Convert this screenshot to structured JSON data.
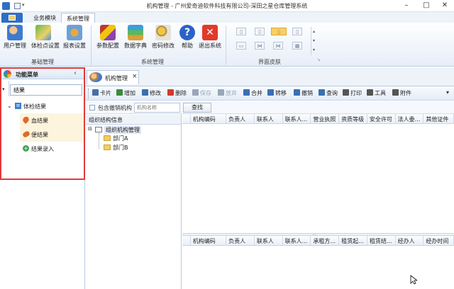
{
  "window": {
    "title": "机构管理 - 广州爱奇迪软件科技有限公司-深田之星仓库管理系统"
  },
  "ribbon_tabs": [
    {
      "label": "业务模块"
    },
    {
      "label": "系统管理"
    }
  ],
  "ribbon_groups": {
    "basic": {
      "label": "基础管理",
      "buttons": [
        {
          "label": "用户管理"
        },
        {
          "label": "体检点设置"
        },
        {
          "label": "报表设置"
        }
      ]
    },
    "system": {
      "label": "系统管理",
      "buttons": [
        {
          "label": "参数配置"
        },
        {
          "label": "数据字典"
        },
        {
          "label": "密码修改"
        },
        {
          "label": "帮助"
        },
        {
          "label": "退出系统"
        }
      ]
    },
    "skin": {
      "label": "界面皮肤"
    }
  },
  "side_menu": {
    "title": "功能菜单",
    "collapse_glyph": "‹",
    "search_value": "结果",
    "tree": {
      "root": "体检结果",
      "children": [
        {
          "label": "血结果"
        },
        {
          "label": "便结果"
        },
        {
          "label": "结果录入"
        }
      ]
    }
  },
  "doc_tab": {
    "label": "机构管理",
    "close": "×"
  },
  "toolbar": [
    {
      "label": "卡片",
      "color": "#4a6fa5"
    },
    {
      "label": "增加",
      "color": "#3c8a3c"
    },
    {
      "label": "修改",
      "color": "#3b6fb0"
    },
    {
      "label": "删除",
      "color": "#d23a2a"
    },
    {
      "label": "保存",
      "color": "#9aa6b8"
    },
    {
      "label": "放弃",
      "color": "#9aa6b8"
    },
    {
      "label": "合并",
      "color": "#3b6fb0"
    },
    {
      "label": "转移",
      "color": "#3b6fb0"
    },
    {
      "label": "撤销",
      "color": "#3b6fb0"
    },
    {
      "label": "查询",
      "color": "#3b6fb0"
    },
    {
      "label": "打印",
      "color": "#555555"
    },
    {
      "label": "工具",
      "color": "#555555"
    },
    {
      "label": "附件",
      "color": "#555555"
    }
  ],
  "filter": {
    "include_cancelled_label": "包含撤销机构",
    "name_placeholder": "机构名称",
    "search_button": "查找"
  },
  "org_tree": {
    "header": "组织结构信息",
    "root": "组织机构管理",
    "children": [
      {
        "label": "部门A"
      },
      {
        "label": "部门B"
      }
    ]
  },
  "grid_top": {
    "columns": [
      "机构编码",
      "负责人",
      "联系人",
      "联系人...",
      "营业执照",
      "资质等级",
      "安全许可",
      "法人委...",
      "其他证件"
    ]
  },
  "grid_bottom": {
    "columns": [
      "机构编码",
      "负责人",
      "联系人",
      "联系人...",
      "承租方...",
      "租赁起...",
      "租赁结...",
      "经办人",
      "经办时间"
    ]
  }
}
